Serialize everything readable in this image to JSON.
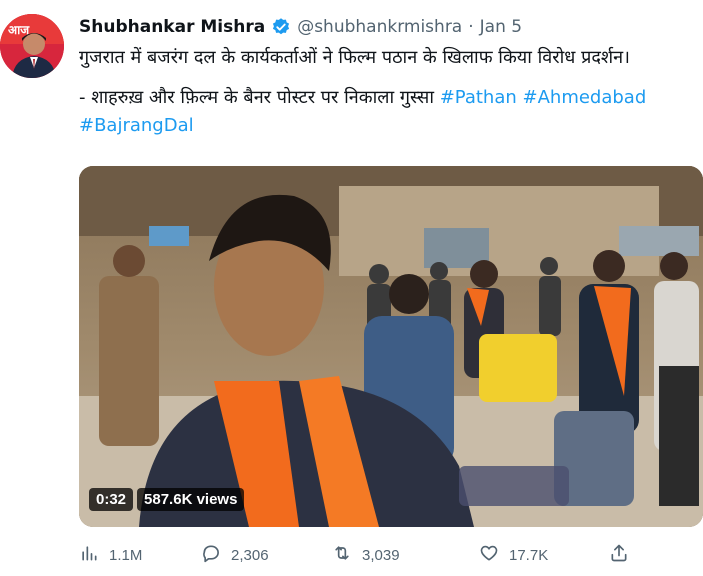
{
  "author": {
    "name": "Shubhankar Mishra",
    "handle": "@shubhankrmishra",
    "separator": "·",
    "date": "Jan 5"
  },
  "tweet": {
    "line1": "गुजरात में बजरंग दल के कार्यकर्ताओं ने फिल्म पठान के खिलाफ किया विरोध प्रदर्शन।",
    "line2_text": "- शाहरुख़ और फ़िल्म के बैनर पोस्टर पर निकाला गुस्सा ",
    "hashtags": [
      "#Pathan",
      "#Ahmedabad",
      "#BajrangDal"
    ]
  },
  "video": {
    "duration": "0:32",
    "views": "587.6K views"
  },
  "actions": {
    "analytics": "1.1M",
    "replies": "2,306",
    "retweets": "3,039",
    "likes": "17.7K"
  },
  "colors": {
    "link": "#1d9bf0",
    "muted": "#536471",
    "verified": "#1d9bf0"
  },
  "icons": [
    "analytics-icon",
    "reply-icon",
    "retweet-icon",
    "like-icon",
    "share-icon",
    "verified-badge-icon"
  ]
}
